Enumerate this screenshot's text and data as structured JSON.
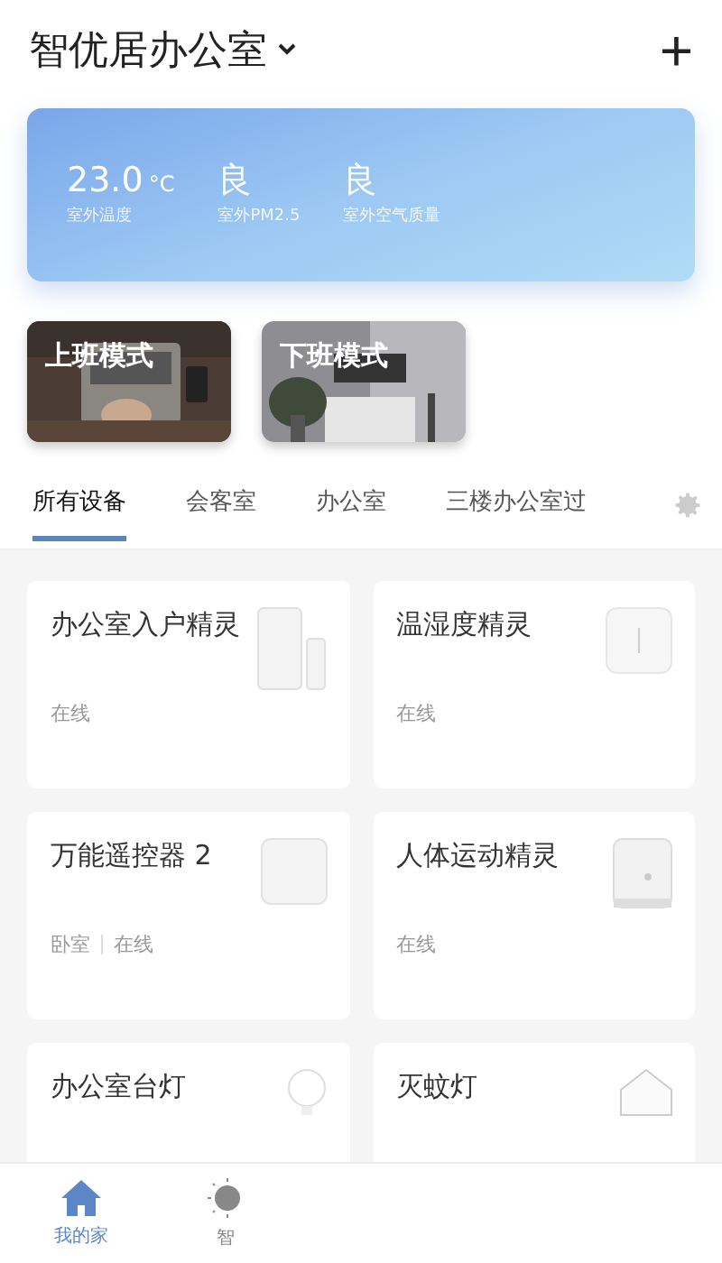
{
  "header": {
    "title": "智优居办公室",
    "add_symbol": "+"
  },
  "weather": [
    {
      "value": "23.0",
      "unit": "°C",
      "label": "室外温度"
    },
    {
      "value": "良",
      "label": "室外PM2.5"
    },
    {
      "value": "良",
      "label": "室外空气质量"
    }
  ],
  "scenes": [
    {
      "label": "上班模式",
      "kind": "picture"
    },
    {
      "label": "下班模式",
      "kind": "picture"
    }
  ],
  "tabs": [
    {
      "label": "所有设备",
      "selected": true
    },
    {
      "label": "会客室",
      "selected": false
    },
    {
      "label": "办公室",
      "selected": false
    },
    {
      "label": "三楼办公室过",
      "selected": false
    }
  ],
  "devices": [
    {
      "name": "办公室入户精灵",
      "status": [
        "在线"
      ],
      "kind": "door-sensor"
    },
    {
      "name": "温湿度精灵",
      "status": [
        "在线"
      ],
      "kind": "square-sensor"
    },
    {
      "name": "万能遥控器 2",
      "status": [
        "卧室",
        "在线"
      ],
      "kind": "remote"
    },
    {
      "name": "人体运动精灵",
      "status": [
        "在线"
      ],
      "kind": "motion-sensor"
    },
    {
      "name": "办公室台灯",
      "kind": "bulb"
    },
    {
      "name": "灭蚊灯",
      "kind": "house"
    }
  ],
  "nav": [
    {
      "label": "我的家",
      "selected": true,
      "kind": "home"
    },
    {
      "label": "智",
      "selected": false,
      "kind": "sun"
    }
  ]
}
